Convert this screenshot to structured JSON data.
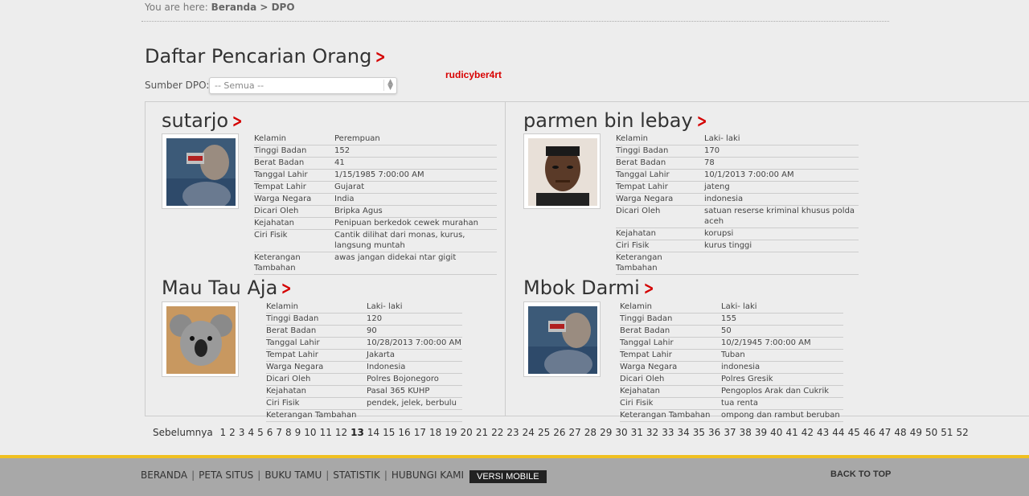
{
  "breadcrumb": {
    "prefix": "You are here:",
    "trail": "Beranda > DPO"
  },
  "page": {
    "title": "Daftar Pencarian Orang",
    "watermark": "rudicyber4rt"
  },
  "filter": {
    "label": "Sumber DPO:",
    "selected": "-- Semua --"
  },
  "cards": [
    {
      "name": "sutarjo",
      "rows": [
        [
          "Kelamin",
          "Perempuan"
        ],
        [
          "Tinggi Badan",
          "152"
        ],
        [
          "Berat Badan",
          "41"
        ],
        [
          "Tanggal Lahir",
          "1/15/1985 7:00:00 AM"
        ],
        [
          "Tempat Lahir",
          "Gujarat"
        ],
        [
          "Warga Negara",
          "India"
        ],
        [
          "Dicari Oleh",
          "Bripka Agus"
        ],
        [
          "Kejahatan",
          "Penipuan berkedok cewek murahan"
        ],
        [
          "Ciri Fisik",
          "Cantik dilihat dari monas, kurus, langsung muntah"
        ],
        [
          "Keterangan Tambahan",
          "awas jangan didekai ntar gigit"
        ]
      ]
    },
    {
      "name": "parmen bin lebay",
      "rows": [
        [
          "Kelamin",
          "Laki- laki"
        ],
        [
          "Tinggi Badan",
          "170"
        ],
        [
          "Berat Badan",
          "78"
        ],
        [
          "Tanggal Lahir",
          "10/1/2013 7:00:00 AM"
        ],
        [
          "Tempat Lahir",
          "jateng"
        ],
        [
          "Warga Negara",
          "indonesia"
        ],
        [
          "Dicari Oleh",
          "satuan reserse kriminal khusus polda aceh"
        ],
        [
          "Kejahatan",
          "korupsi"
        ],
        [
          "Ciri Fisik",
          "kurus tinggi"
        ],
        [
          "Keterangan Tambahan",
          ""
        ]
      ]
    },
    {
      "name": "Mau Tau Aja",
      "rows": [
        [
          "Kelamin",
          "Laki- laki"
        ],
        [
          "Tinggi Badan",
          "120"
        ],
        [
          "Berat Badan",
          "90"
        ],
        [
          "Tanggal Lahir",
          "10/28/2013 7:00:00 AM"
        ],
        [
          "Tempat Lahir",
          "Jakarta"
        ],
        [
          "Warga Negara",
          "Indonesia"
        ],
        [
          "Dicari Oleh",
          "Polres Bojonegoro"
        ],
        [
          "Kejahatan",
          "Pasal 365 KUHP"
        ],
        [
          "Ciri Fisik",
          "pendek, jelek, berbulu"
        ],
        [
          "Keterangan Tambahan",
          ""
        ]
      ]
    },
    {
      "name": "Mbok Darmi",
      "rows": [
        [
          "Kelamin",
          "Laki- laki"
        ],
        [
          "Tinggi Badan",
          "155"
        ],
        [
          "Berat Badan",
          "50"
        ],
        [
          "Tanggal Lahir",
          "10/2/1945 7:00:00 AM"
        ],
        [
          "Tempat Lahir",
          "Tuban"
        ],
        [
          "Warga Negara",
          "indonesia"
        ],
        [
          "Dicari Oleh",
          "Polres Gresik"
        ],
        [
          "Kejahatan",
          "Pengoplos Arak dan Cukrik"
        ],
        [
          "Ciri Fisik",
          "tua renta"
        ],
        [
          "Keterangan Tambahan",
          "ompong dan rambut beruban"
        ]
      ]
    }
  ],
  "pagination": {
    "prev": "Sebelumnya",
    "current": "13",
    "pages": [
      "1",
      "2",
      "3",
      "4",
      "5",
      "6",
      "7",
      "8",
      "9",
      "10",
      "11",
      "12",
      "13",
      "14",
      "15",
      "16",
      "17",
      "18",
      "19",
      "20",
      "21",
      "22",
      "23",
      "24",
      "25",
      "26",
      "27",
      "28",
      "29",
      "30",
      "31",
      "32",
      "33",
      "34",
      "35",
      "36",
      "37",
      "38",
      "39",
      "40",
      "41",
      "42",
      "43",
      "44",
      "45",
      "46",
      "47",
      "48",
      "49",
      "50",
      "51",
      "52"
    ]
  },
  "footer": {
    "links": [
      "BERANDA",
      "PETA SITUS",
      "BUKU TAMU",
      "STATISTIK",
      "HUBUNGI KAMI"
    ],
    "mobile": "VERSI MOBILE",
    "back_to_top": "BACK TO TOP"
  },
  "colors": {
    "accent": "#d40000",
    "footer_stripe": "#f0c020",
    "footer_bg": "#a8a8a8"
  }
}
